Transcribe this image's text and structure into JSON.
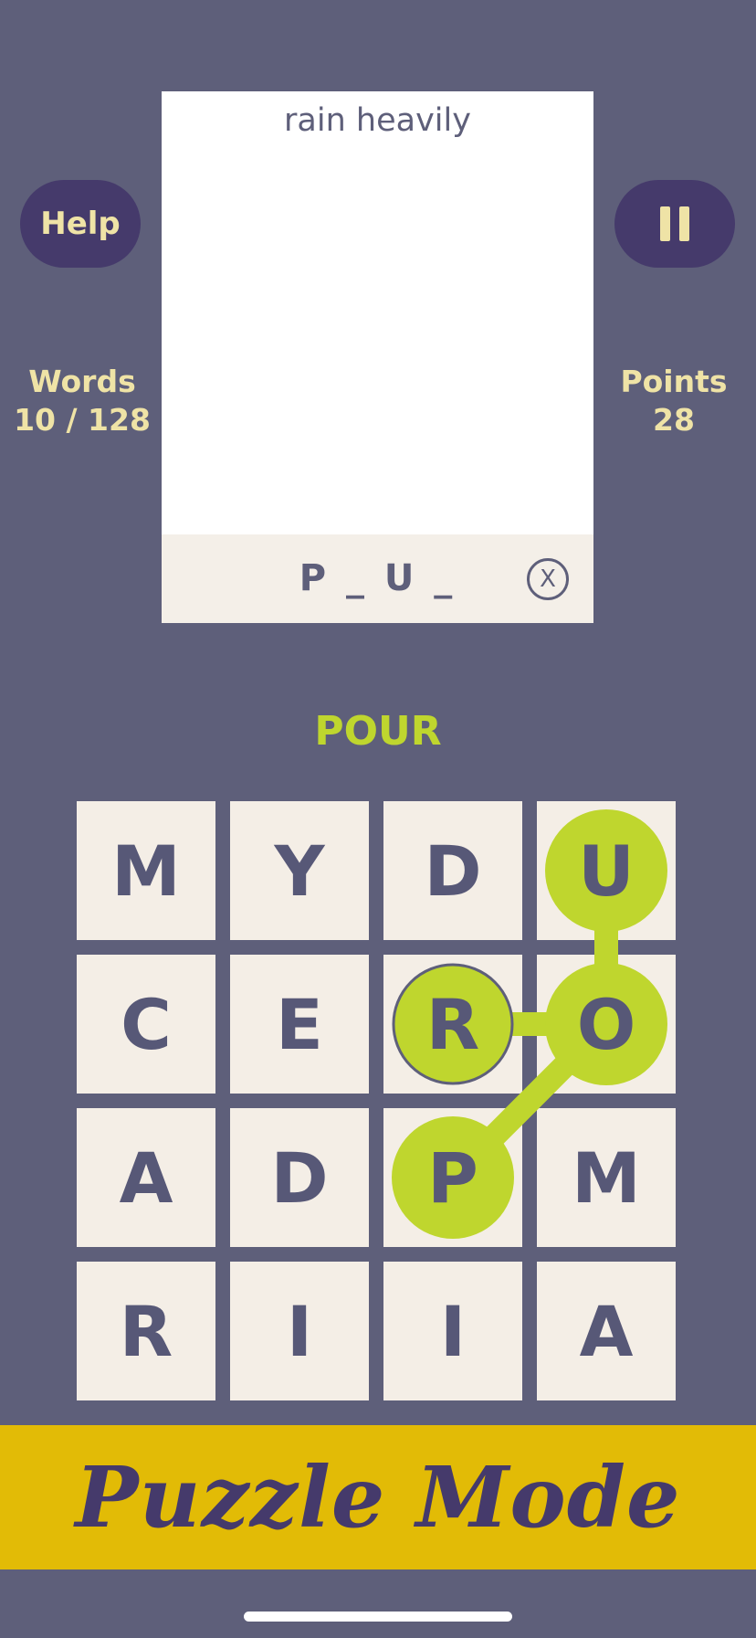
{
  "header": {
    "help_label": "Help",
    "pause_icon": "pause-icon"
  },
  "stats": {
    "words_label": "Words",
    "words_value": "10 / 128",
    "points_label": "Points",
    "points_value": "28"
  },
  "clue": {
    "text": "rain heavily",
    "hint": "P _ U _",
    "clear_icon": "close-circle-icon",
    "clear_glyph": "X"
  },
  "current_word": "POUR",
  "grid": {
    "rows": 4,
    "cols": 4,
    "letters": [
      "M",
      "Y",
      "D",
      "U",
      "C",
      "E",
      "R",
      "O",
      "A",
      "D",
      "P",
      "M",
      "R",
      "I",
      "I",
      "A"
    ],
    "path": [
      10,
      7,
      3,
      7,
      6
    ],
    "selected": [
      3,
      6,
      7,
      10
    ]
  },
  "banner": {
    "title": "Puzzle Mode"
  },
  "colors": {
    "background": "#5e5f7a",
    "button": "#453a6b",
    "accent_text": "#efe3a6",
    "selection": "#bfd62e",
    "tile": "#f4eee6",
    "banner": "#e2bb06"
  }
}
